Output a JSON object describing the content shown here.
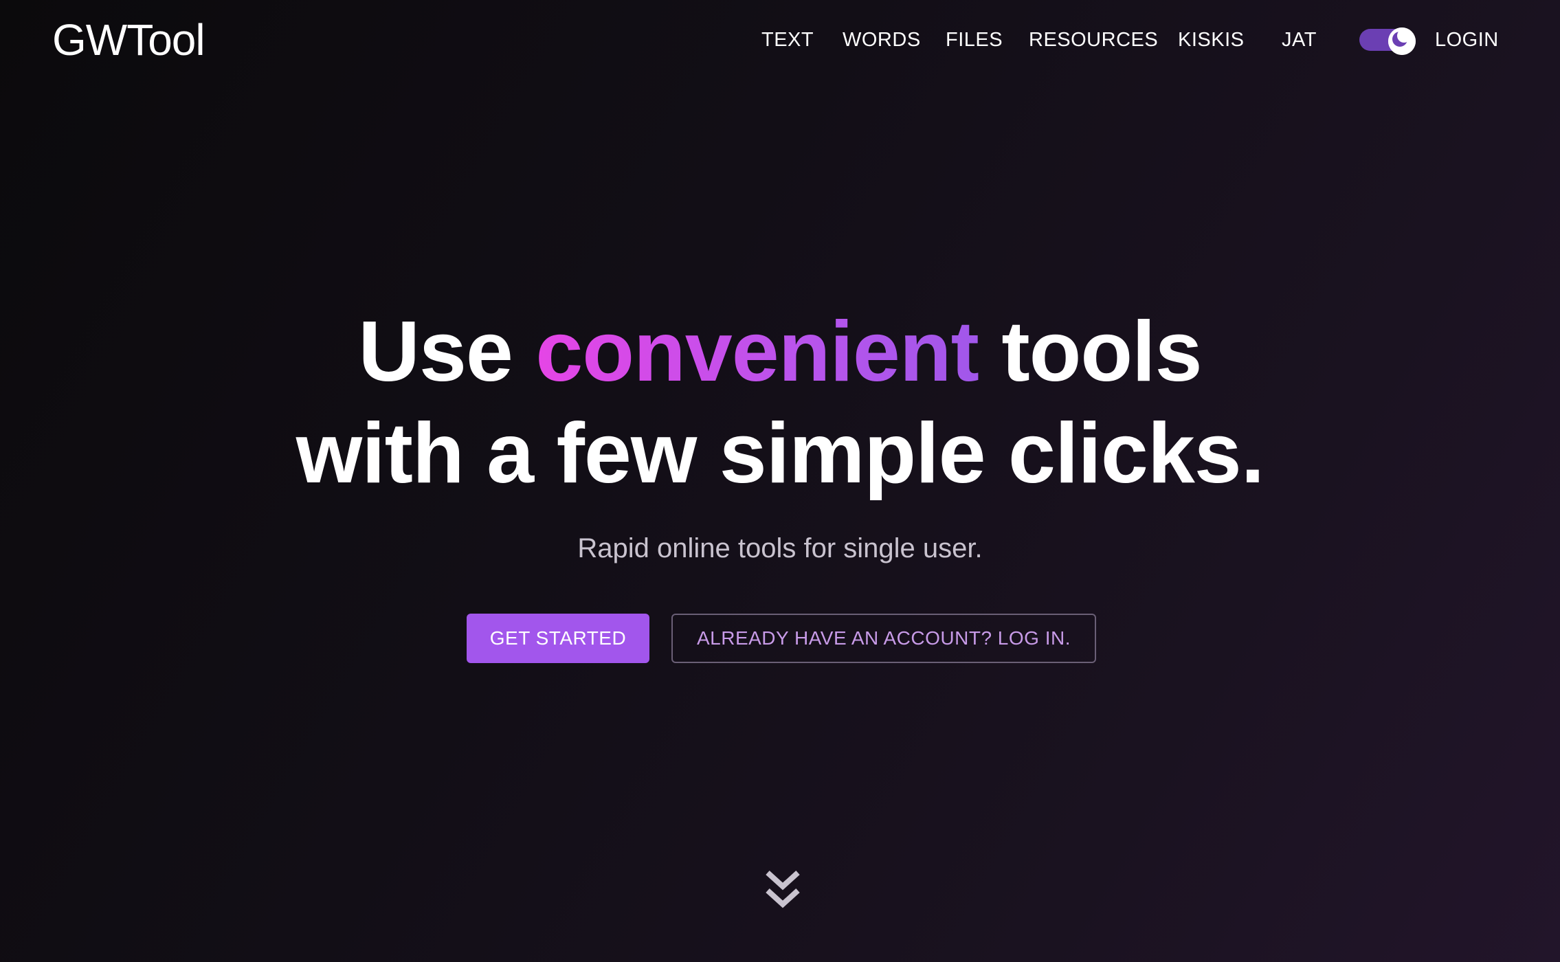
{
  "brand": {
    "logo_text": "GWTool"
  },
  "nav": {
    "items": [
      {
        "label": "TEXT"
      },
      {
        "label": "WORDS"
      },
      {
        "label": "FILES"
      },
      {
        "label": "RESOURCES"
      },
      {
        "label": "KISKIS"
      },
      {
        "label": "JAT"
      }
    ],
    "login_label": "LOGIN",
    "theme_toggle": {
      "state": "dark",
      "icon": "moon-icon"
    }
  },
  "hero": {
    "title_before": "Use",
    "title_accent": "convenient",
    "title_after": "tools",
    "title_line2": "with a few simple clicks.",
    "subtitle": "Rapid online tools for single user.",
    "primary_button": "GET STARTED",
    "secondary_button": "ALREADY HAVE AN ACCOUNT? LOG IN."
  },
  "scroll_icon": "double-chevron-down-icon",
  "colors": {
    "accent": "#a256ec",
    "accent_gradient_start": "#e545e6",
    "toggle_track": "#6b3fb3",
    "secondary_text": "#c89be8"
  }
}
